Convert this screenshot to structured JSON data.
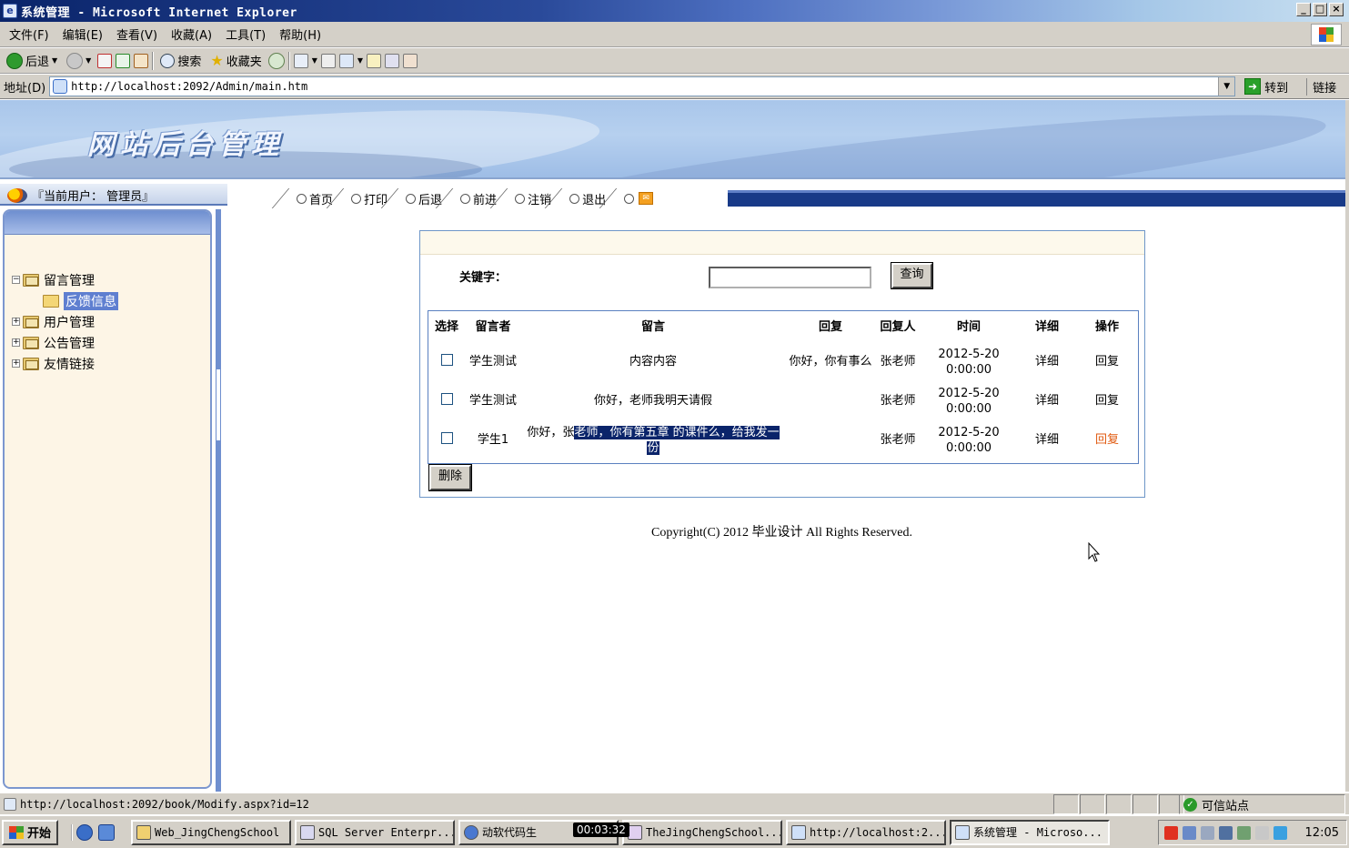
{
  "window": {
    "title": "系统管理 - Microsoft Internet Explorer",
    "buttons": [
      "_",
      "□",
      "×"
    ]
  },
  "menu": [
    "文件(F)",
    "编辑(E)",
    "查看(V)",
    "收藏(A)",
    "工具(T)",
    "帮助(H)"
  ],
  "toolbar": {
    "back": "后退",
    "search": "搜索",
    "favorites": "收藏夹"
  },
  "address": {
    "label": "地址(D)",
    "url": "http://localhost:2092/Admin/main.htm",
    "go": "转到",
    "links": "链接"
  },
  "site": {
    "banner_title": "网站后台管理",
    "current_user": "『当前用户： 管理员』",
    "nav": [
      "首页",
      "打印",
      "后退",
      "前进",
      "注销",
      "退出"
    ]
  },
  "tree": {
    "nodes": [
      {
        "label": "留言管理",
        "expander": "−",
        "children": [
          {
            "label": "反馈信息"
          }
        ]
      },
      {
        "label": "用户管理",
        "expander": "+"
      },
      {
        "label": "公告管理",
        "expander": "+"
      },
      {
        "label": "友情链接",
        "expander": "+"
      }
    ]
  },
  "search": {
    "label": "关键字：",
    "value": "",
    "button": "查询"
  },
  "grid": {
    "headers": [
      "选择",
      "留言者",
      "留言",
      "回复",
      "回复人",
      "时间",
      "详细",
      "操作"
    ],
    "rows": [
      {
        "author": "学生测试",
        "message_pre": "内容内容",
        "message_sel": "",
        "reply": "你好，你有事么",
        "replier": "张老师",
        "time": "2012-5-20 0:00:00",
        "detail": "详细",
        "action": "回复"
      },
      {
        "author": "学生测试",
        "message_pre": "你好，老师我明天请假",
        "message_sel": "",
        "reply": "",
        "replier": "张老师",
        "time": "2012-5-20 0:00:00",
        "detail": "详细",
        "action": "回复"
      },
      {
        "author": "学生1",
        "message_pre": "你好，张",
        "message_sel": "老师，你有第五章 的课件么，给我发一份",
        "reply": "",
        "replier": "张老师",
        "time": "2012-5-20 0:00:00",
        "detail": "详细",
        "action": "回复"
      }
    ],
    "delete_button": "删除"
  },
  "footer": {
    "copyright": "Copyright(C) 2012 毕业设计  All Rights Reserved."
  },
  "status": {
    "url": "http://localhost:2092/book/Modify.aspx?id=12",
    "zone": "可信站点"
  },
  "taskbar": {
    "start": "开始",
    "tasks": [
      "Web_JingChengSchool",
      "SQL Server Enterpr...",
      "动软代码生",
      "TheJingChengSchool...",
      "http://localhost:2...",
      "系统管理 - Microso..."
    ],
    "clock": "12:05",
    "timer": "00:03:32"
  },
  "colors": {
    "accent": "#0a246a",
    "panel_border": "#6e96c8",
    "sidebar_bg": "#fdf5e6",
    "hover_link": "#e05a10"
  }
}
